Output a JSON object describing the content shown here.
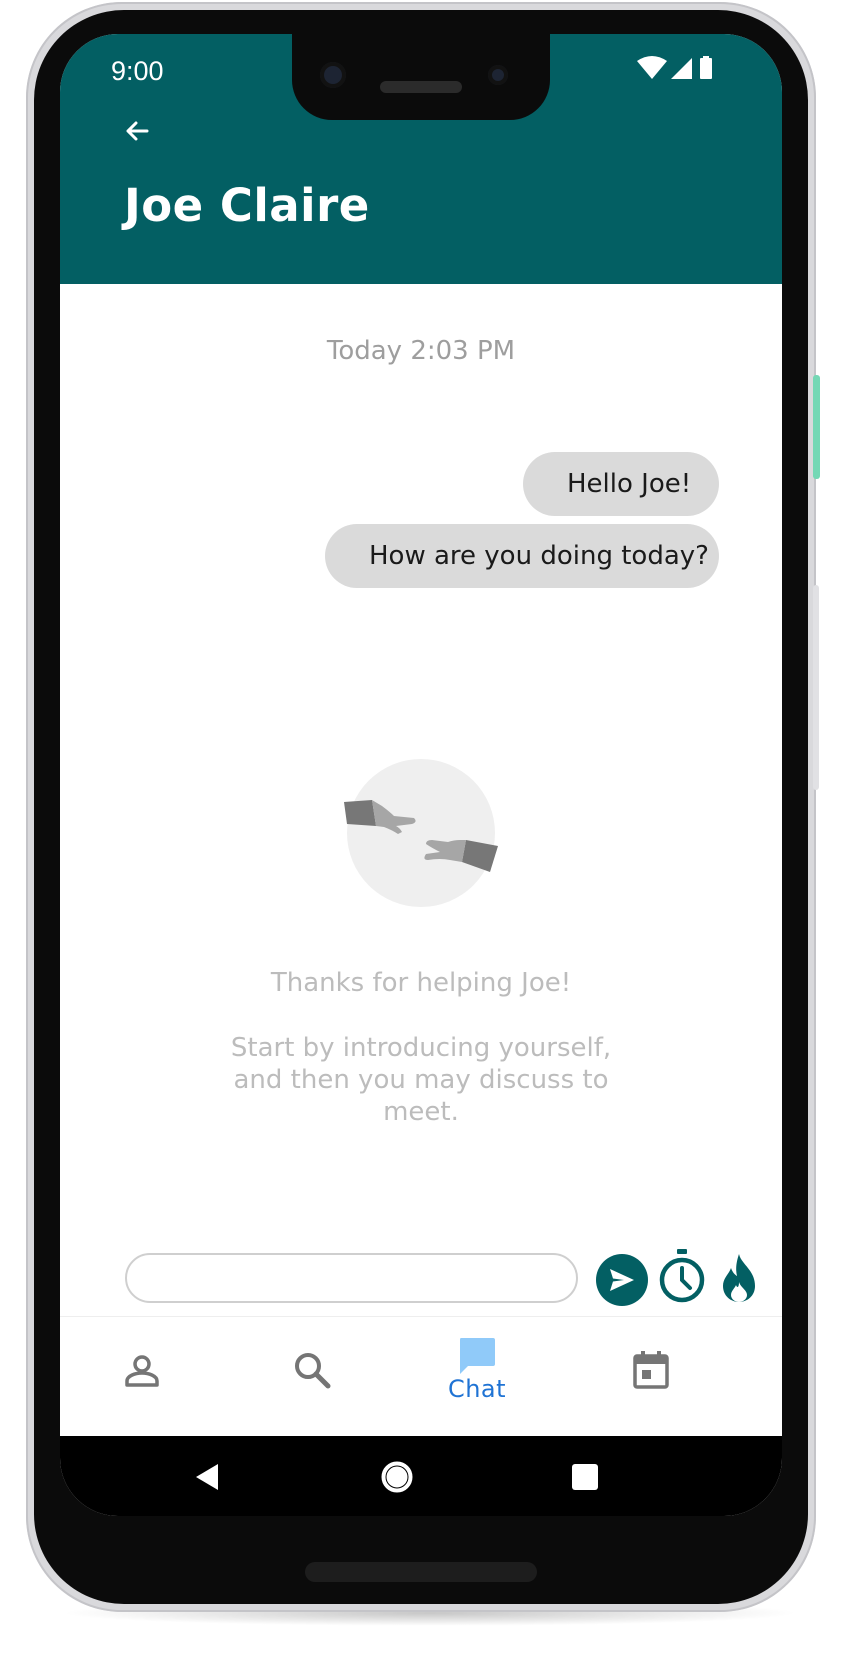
{
  "status_bar": {
    "time": "9:00",
    "icons": [
      "wifi-icon",
      "signal-icon",
      "battery-icon"
    ]
  },
  "header": {
    "back_icon": "arrow-left-icon",
    "title": "Joe Claire"
  },
  "chat": {
    "timestamp": "Today 2:03 PM",
    "messages": [
      {
        "text": "Hello Joe!",
        "sender": "me"
      },
      {
        "text": "How are you doing today?",
        "sender": "me"
      }
    ],
    "empty_state": {
      "illustration": "reaching-hands-illustration",
      "title": "Thanks for helping Joe!",
      "body": "Start by introducing yourself, and then you may discuss to meet."
    }
  },
  "composer": {
    "input_value": "",
    "placeholder": "",
    "actions": [
      "send-icon",
      "timer-icon",
      "fire-icon"
    ]
  },
  "bottom_nav": {
    "items": [
      {
        "icon": "person-icon",
        "label": ""
      },
      {
        "icon": "search-icon",
        "label": ""
      },
      {
        "icon": "chat-bubble-icon",
        "label": "Chat",
        "active": true
      },
      {
        "icon": "calendar-icon",
        "label": ""
      }
    ]
  },
  "system_nav": {
    "buttons": [
      "back-triangle-icon",
      "home-circle-icon",
      "recents-square-icon"
    ]
  },
  "colors": {
    "header": "#035f63",
    "accent": "#035f63",
    "active_tab": "#1f73d4",
    "active_tab_icon": "#90caf9",
    "bubble": "#dadada"
  }
}
